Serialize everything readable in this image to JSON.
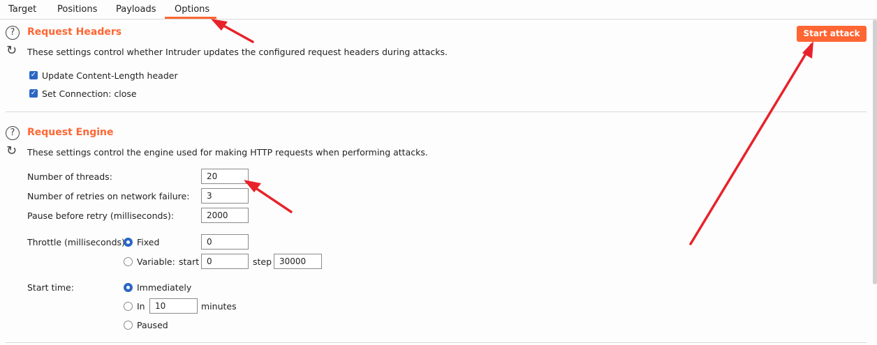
{
  "tabs": [
    {
      "label": "Target"
    },
    {
      "label": "Positions"
    },
    {
      "label": "Payloads"
    },
    {
      "label": "Options",
      "active": true
    }
  ],
  "accent_color": "#ff6633",
  "start_attack_label": "Start attack",
  "request_headers": {
    "title": "Request Headers",
    "description": "These settings control whether Intruder updates the configured request headers during attacks.",
    "options": [
      {
        "label": "Update Content-Length header",
        "checked": true
      },
      {
        "label": "Set Connection: close",
        "checked": true
      }
    ]
  },
  "request_engine": {
    "title": "Request Engine",
    "description": "These settings control the engine used for making HTTP requests when performing attacks.",
    "threads_label": "Number of threads:",
    "threads_value": "20",
    "retries_label": "Number of retries on network failure:",
    "retries_value": "3",
    "pause_label": "Pause before retry (milliseconds):",
    "pause_value": "2000",
    "throttle_label": "Throttle (milliseconds):",
    "throttle_fixed_label": "Fixed",
    "throttle_fixed_value": "0",
    "throttle_variable_label": "Variable:",
    "throttle_start_label": "start",
    "throttle_start_value": "0",
    "throttle_step_label": "step",
    "throttle_step_value": "30000",
    "start_time_label": "Start time:",
    "start_immediately_label": "Immediately",
    "start_in_label": "In",
    "start_in_value": "10",
    "start_minutes_label": "minutes",
    "start_paused_label": "Paused"
  },
  "icons": {
    "help": "?",
    "refresh": "↻",
    "check": "✓"
  }
}
